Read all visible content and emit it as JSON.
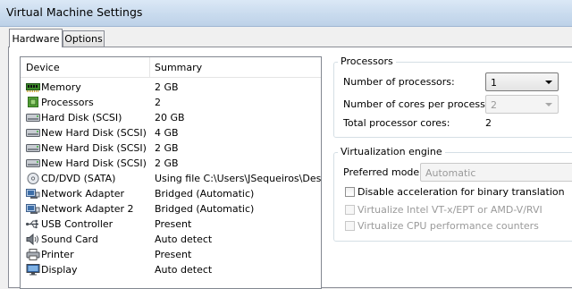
{
  "window": {
    "title": "Virtual Machine Settings"
  },
  "tabs": [
    {
      "label": "Hardware",
      "active": true
    },
    {
      "label": "Options",
      "active": false
    }
  ],
  "device_list": {
    "columns": {
      "device": "Device",
      "summary": "Summary"
    },
    "rows": [
      {
        "icon": "memory-icon",
        "device": "Memory",
        "summary": "2 GB"
      },
      {
        "icon": "processor-icon",
        "device": "Processors",
        "summary": "2"
      },
      {
        "icon": "hard-disk-icon",
        "device": "Hard Disk (SCSI)",
        "summary": "20 GB"
      },
      {
        "icon": "hard-disk-icon",
        "device": "New Hard Disk (SCSI)",
        "summary": "4 GB"
      },
      {
        "icon": "hard-disk-icon",
        "device": "New Hard Disk (SCSI)",
        "summary": "2 GB"
      },
      {
        "icon": "hard-disk-icon",
        "device": "New Hard Disk (SCSI)",
        "summary": "2 GB"
      },
      {
        "icon": "cd-dvd-icon",
        "device": "CD/DVD (SATA)",
        "summary": "Using file C:\\Users\\JSequeiros\\Desktop"
      },
      {
        "icon": "network-adapter-icon",
        "device": "Network Adapter",
        "summary": "Bridged (Automatic)"
      },
      {
        "icon": "network-adapter-icon",
        "device": "Network Adapter 2",
        "summary": "Bridged (Automatic)"
      },
      {
        "icon": "usb-icon",
        "device": "USB Controller",
        "summary": "Present"
      },
      {
        "icon": "sound-card-icon",
        "device": "Sound Card",
        "summary": "Auto detect"
      },
      {
        "icon": "printer-icon",
        "device": "Printer",
        "summary": "Present"
      },
      {
        "icon": "display-icon",
        "device": "Display",
        "summary": "Auto detect"
      }
    ]
  },
  "processors": {
    "group_label": "Processors",
    "num_processors_label": "Number of processors:",
    "num_processors_value": "1",
    "cores_label": "Number of cores per processor:",
    "cores_value": "2",
    "total_label": "Total processor cores:",
    "total_value": "2"
  },
  "virtualization": {
    "group_label": "Virtualization engine",
    "preferred_mode_label": "Preferred mode:",
    "preferred_mode_value": "Automatic",
    "options": [
      {
        "label": "Disable acceleration for binary translation",
        "enabled": true,
        "checked": false
      },
      {
        "label": "Virtualize Intel VT-x/EPT or AMD-V/RVI",
        "enabled": false,
        "checked": false
      },
      {
        "label": "Virtualize CPU performance counters",
        "enabled": false,
        "checked": false
      }
    ]
  }
}
